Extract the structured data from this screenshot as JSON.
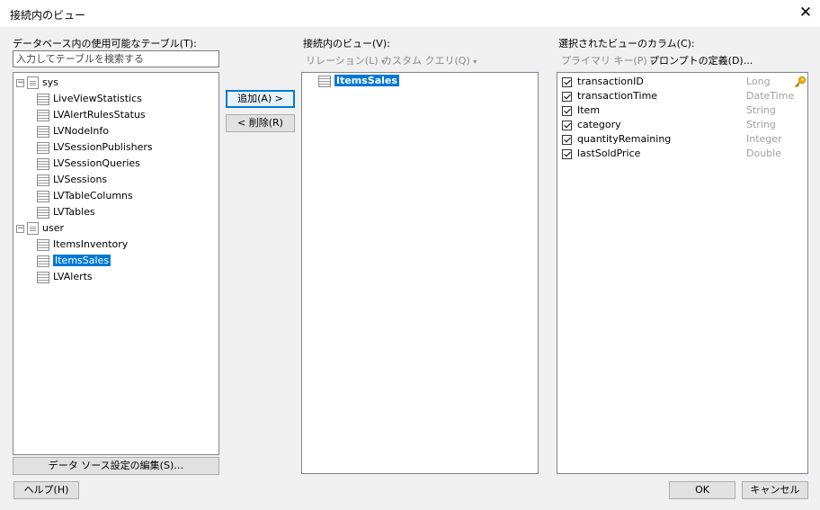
{
  "window": {
    "title": "接続内のビュー"
  },
  "left": {
    "label": "データベース内の使用可能なテーブル(T):",
    "search_placeholder": "入力してテーブルを検索する",
    "tree": [
      {
        "name": "sys",
        "items": [
          "LiveViewStatistics",
          "LVAlertRulesStatus",
          "LVNodeInfo",
          "LVSessionPublishers",
          "LVSessionQueries",
          "LVSessions",
          "LVTableColumns",
          "LVTables"
        ]
      },
      {
        "name": "user",
        "items": [
          "ItemsInventory",
          "ItemsSales",
          "LVAlerts"
        ]
      }
    ],
    "selected": "ItemsSales",
    "edit_button": "データ ソース設定の編集(S)…"
  },
  "middle": {
    "add_button": "追加(A) >",
    "remove_button": "< 削除(R)",
    "label": "接続内のビュー(V):",
    "relation": "リレーション(L)",
    "custom_query": "カスタム クエリ(Q)",
    "views": [
      "ItemsSales"
    ]
  },
  "right": {
    "label": "選択されたビューのカラム(C):",
    "primary_key": "プライマリ キー(P)",
    "prompt_def": "プロンプトの定義(D)...",
    "columns": [
      {
        "name": "transactionID",
        "type": "Long",
        "checked": true,
        "key": true
      },
      {
        "name": "transactionTime",
        "type": "DateTime",
        "checked": true,
        "key": false
      },
      {
        "name": "Item",
        "type": "String",
        "checked": true,
        "key": false
      },
      {
        "name": "category",
        "type": "String",
        "checked": true,
        "key": false
      },
      {
        "name": "quantityRemaining",
        "type": "Integer",
        "checked": true,
        "key": false
      },
      {
        "name": "lastSoldPrice",
        "type": "Double",
        "checked": true,
        "key": false
      }
    ]
  },
  "footer": {
    "help": "ヘルプ(H)",
    "ok": "OK",
    "cancel": "キャンセル"
  },
  "colors": {
    "accent": "#0078d7",
    "disabled_text": "#8a8a8a",
    "key_icon": "#e8b400"
  }
}
